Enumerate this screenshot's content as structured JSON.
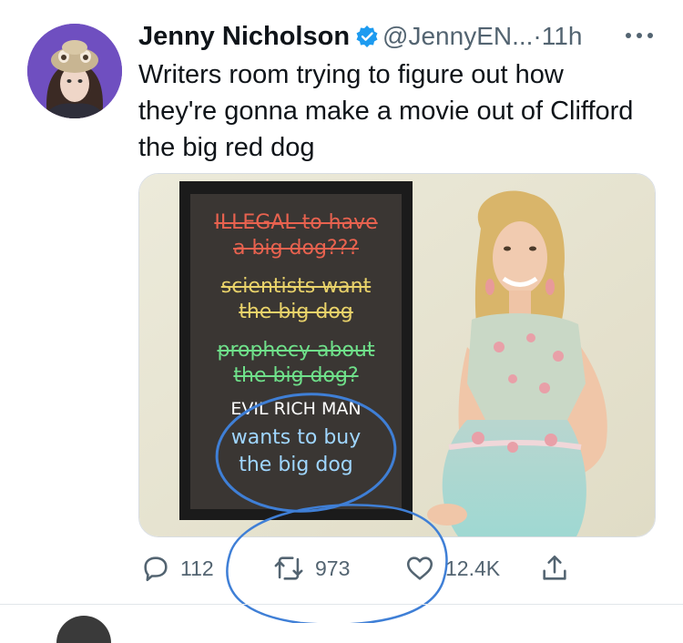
{
  "tweet": {
    "author_name": "Jenny Nicholson",
    "handle": "@JennyEN...",
    "separator": "·",
    "time": "11h",
    "more_icon": "more-dots-icon",
    "text": "Writers room trying to figure out how they're gonna make a movie out of Clifford the big red dog"
  },
  "chalkboard": {
    "lines": [
      {
        "text": "ILLEGAL to have",
        "color": "#e8624f"
      },
      {
        "text": "a big dog???",
        "color": "#e8624f"
      },
      {
        "text": "scientists want",
        "color": "#e9d26a"
      },
      {
        "text": "the big dog",
        "color": "#e9d26a"
      },
      {
        "text": "prophecy about",
        "color": "#6fe08a"
      },
      {
        "text": "the big dog?",
        "color": "#6fe08a"
      },
      {
        "text": "EVIL RICH MAN",
        "color": "#ffffff"
      },
      {
        "text": "wants to buy",
        "color": "#9fd6ff"
      },
      {
        "text": "the big dog",
        "color": "#9fd6ff"
      }
    ]
  },
  "actions": {
    "reply_count": "112",
    "retweet_count": "973",
    "like_count": "12.4K",
    "share_icon": "share-icon"
  },
  "colors": {
    "verified": "#1d9bf0",
    "annotation_blue": "#3f7fd6",
    "muted_text": "#536471"
  }
}
